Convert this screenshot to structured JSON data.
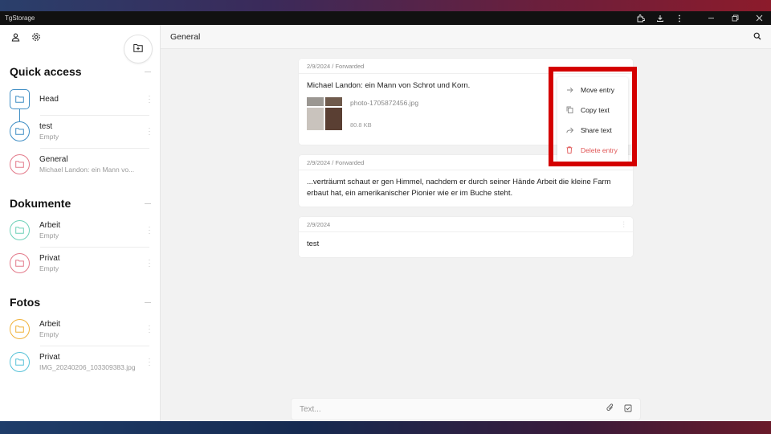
{
  "window": {
    "title": "TgStorage"
  },
  "sidebar": {
    "sections": [
      {
        "title": "Quick access"
      },
      {
        "title": "Dokumente"
      },
      {
        "title": "Fotos"
      }
    ],
    "items": [
      {
        "name": "Head",
        "sub": "",
        "color": "#3f8ec4"
      },
      {
        "name": "test",
        "sub": "Empty",
        "color": "#3f8ec4"
      },
      {
        "name": "General",
        "sub": "Michael Landon: ein Mann vo...",
        "color": "#e37a8a"
      },
      {
        "name": "Arbeit",
        "sub": "Empty",
        "color": "#6fd1b8"
      },
      {
        "name": "Privat",
        "sub": "Empty",
        "color": "#e37a8a"
      },
      {
        "name": "Arbeit",
        "sub": "Empty",
        "color": "#f0b23a"
      },
      {
        "name": "Privat",
        "sub": "IMG_20240206_103309383.jpg",
        "color": "#57c2d8"
      }
    ]
  },
  "main": {
    "title": "General",
    "entries": [
      {
        "meta": "2/9/2024 / Forwarded",
        "text": "Michael Landon: ein Mann von Schrot und Korn.",
        "file_name": "photo-1705872456.jpg",
        "file_size": "80.8 KB"
      },
      {
        "meta": "2/9/2024 / Forwarded",
        "text": "...verträumt schaut er gen Himmel, nachdem er durch seiner Hände Arbeit die kleine Farm erbaut hat, ein amerikanischer Pionier wie er im Buche steht."
      },
      {
        "meta": "2/9/2024",
        "text": "test"
      }
    ],
    "context_menu": [
      {
        "label": "Move entry",
        "icon": "arrow-right-icon"
      },
      {
        "label": "Copy text",
        "icon": "copy-icon"
      },
      {
        "label": "Share text",
        "icon": "share-icon"
      },
      {
        "label": "Delete entry",
        "icon": "trash-icon",
        "danger": true
      }
    ],
    "input": {
      "placeholder": "Text..."
    }
  },
  "colors": {
    "highlight": "#d40000",
    "danger": "#e05555"
  }
}
